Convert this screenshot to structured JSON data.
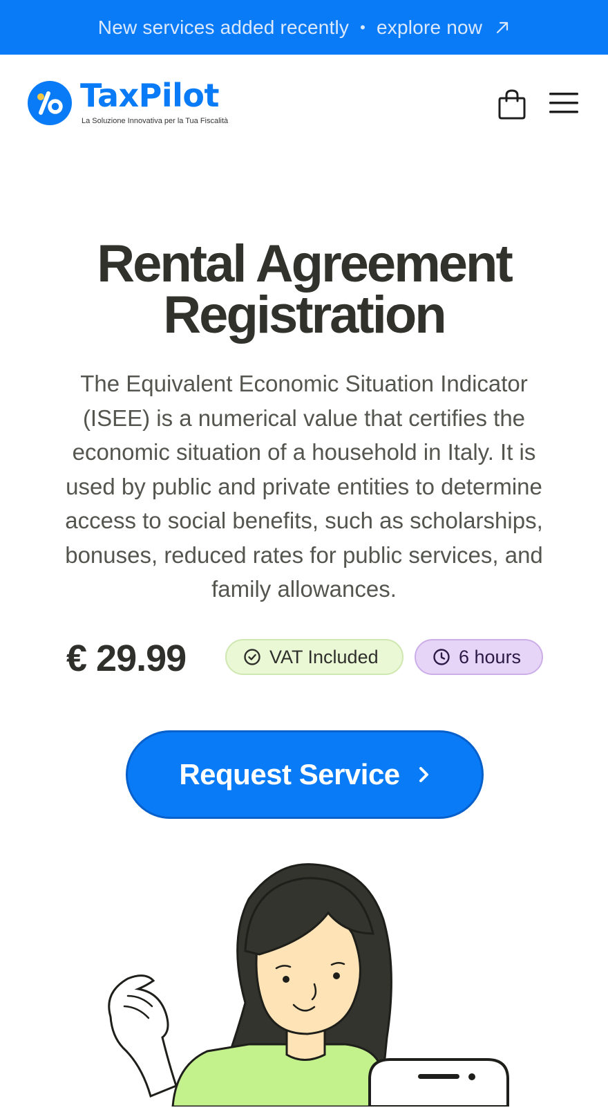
{
  "announcement": {
    "text": "New services added recently",
    "separator": "•",
    "link": "explore now",
    "link_icon": "arrow-up-right-icon"
  },
  "header": {
    "logo_name": "TaxPilot",
    "logo_tagline": "La Soluzione Innovativa per la Tua Fiscalità",
    "cart_icon": "shopping-bag-icon",
    "menu_icon": "hamburger-menu-icon"
  },
  "hero": {
    "title": "Rental Agreement Registration",
    "description": "The Equivalent Economic Situation Indicator (ISEE) is a numerical value that certifies the economic situation of a household in Italy. It is used by public and private entities to determine access to social benefits, such as scholarships, bonuses, reduced rates for public services, and family allowances."
  },
  "pricing": {
    "price": "€ 29.99",
    "vat_badge": "VAT Included",
    "time_badge": "6 hours"
  },
  "cta": {
    "label": "Request Service"
  },
  "colors": {
    "brand_blue": "#0a7bf7",
    "vat_badge_bg": "#eaf8d6",
    "time_badge_bg": "#e7d5f7",
    "heading": "#32322c"
  }
}
